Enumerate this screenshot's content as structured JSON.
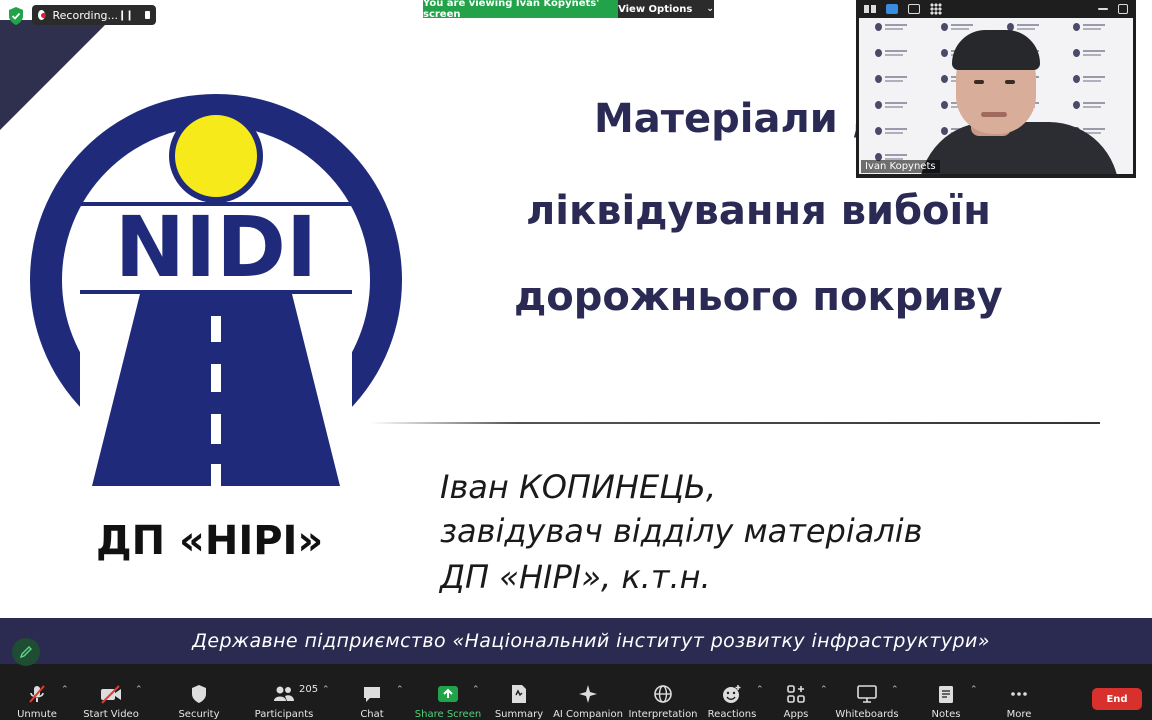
{
  "top_bar": {
    "recording_label": "Recording...",
    "viewing_banner": "You are viewing Ivan Kopynets' screen",
    "view_options_label": "View Options"
  },
  "slide": {
    "logo_text": "NIDI",
    "org_short": "ДП «НІРІ»",
    "title_lines": [
      "Матеріали ,",
      "ліквідування вибоїн",
      "дорожнього покриву"
    ],
    "author_lines": [
      "Іван КОПИНЕЦЬ,",
      "завідувач відділу матеріалів",
      "ДП «НІРІ», к.т.н."
    ],
    "footer": "Державне підприємство «Національний інститут розвитку інфраструктури»",
    "colors": {
      "logo_blue": "#1f2b7a",
      "sun_yellow": "#f7ea1a",
      "title": "#2a2a55",
      "footer_band": "#2b2b52"
    }
  },
  "video": {
    "participant_name": "Ivan Kopynets"
  },
  "toolbar": {
    "items": [
      {
        "label": "Unmute",
        "icon": "mic-muted-icon"
      },
      {
        "label": "Start Video",
        "icon": "video-off-icon"
      },
      {
        "label": "Security",
        "icon": "shield-icon"
      },
      {
        "label": "Participants",
        "icon": "participants-icon",
        "badge": "205"
      },
      {
        "label": "Chat",
        "icon": "chat-icon"
      },
      {
        "label": "Share Screen",
        "icon": "share-screen-icon"
      },
      {
        "label": "Summary",
        "icon": "summary-icon"
      },
      {
        "label": "AI Companion",
        "icon": "ai-companion-icon"
      },
      {
        "label": "Interpretation",
        "icon": "globe-icon"
      },
      {
        "label": "Reactions",
        "icon": "reactions-icon"
      },
      {
        "label": "Apps",
        "icon": "apps-icon"
      },
      {
        "label": "Whiteboards",
        "icon": "whiteboard-icon"
      },
      {
        "label": "Notes",
        "icon": "notes-icon"
      },
      {
        "label": "More",
        "icon": "more-icon"
      }
    ],
    "end_label": "End",
    "colors": {
      "end": "#d8302c",
      "share": "#22a34a"
    }
  }
}
